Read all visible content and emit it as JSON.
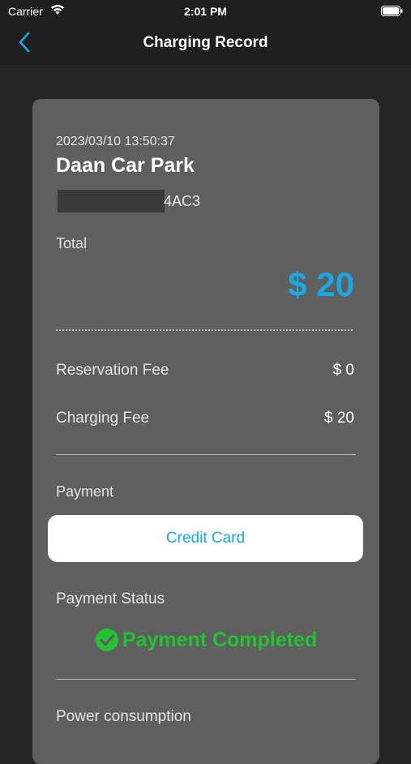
{
  "status_bar": {
    "carrier": "Carrier",
    "time": "2:01 PM"
  },
  "nav": {
    "title": "Charging Record",
    "back_icon": "chevron-left-icon"
  },
  "record": {
    "timestamp": "2023/03/10 13:50:37",
    "station_name": "Daan Car Park",
    "plate_suffix": "4AC3",
    "total_label": "Total",
    "total_value": "$ 20",
    "fees": [
      {
        "label": "Reservation Fee",
        "value": "$ 0"
      },
      {
        "label": "Charging Fee",
        "value": "$ 20"
      }
    ],
    "payment_label": "Payment",
    "payment_method": "Credit Card",
    "payment_status_label": "Payment Status",
    "payment_status": "Payment Completed",
    "power_consumption_label": "Power consumption"
  },
  "colors": {
    "accent": "#17a8e6",
    "success": "#22c232",
    "card_bg": "#5f5f5f",
    "page_bg": "#262626"
  }
}
